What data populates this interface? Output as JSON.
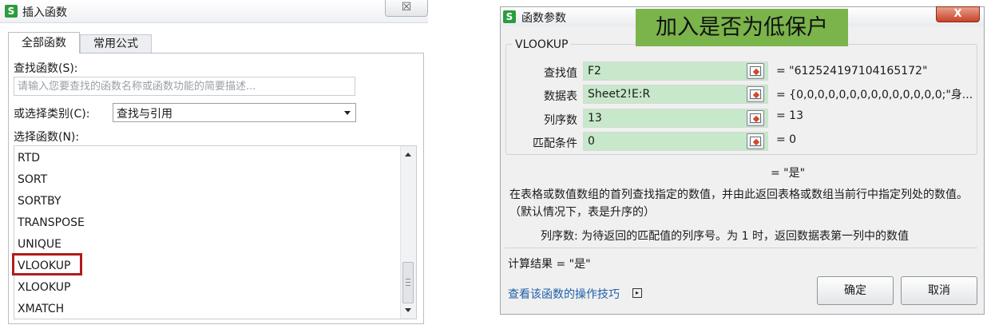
{
  "colors": {
    "app_logo": "#2c9c3e",
    "highlight_box": "#b01c1c",
    "annotation_banner": "#7ab44b",
    "arg_field_bg": "#c7e8cb",
    "link": "#1f5fa8",
    "close_button": "#c7432a"
  },
  "insert_dialog": {
    "logo": "S",
    "title": "插入函数",
    "close_glyph": "☒",
    "tabs": [
      {
        "label": "全部函数",
        "selected": true
      },
      {
        "label": "常用公式",
        "selected": false
      }
    ],
    "search_label": "查找函数(S):",
    "search_placeholder": "请输入您要查找的函数名称或函数功能的简要描述...",
    "category_label": "或选择类别(C):",
    "category_value": "查找与引用",
    "function_label": "选择函数(N):",
    "functions": [
      "RTD",
      "SORT",
      "SORTBY",
      "TRANSPOSE",
      "UNIQUE",
      "VLOOKUP",
      "XLOOKUP",
      "XMATCH"
    ],
    "selected_function": "VLOOKUP"
  },
  "args_dialog": {
    "logo": "S",
    "title": "函数参数",
    "close_glyph": "X",
    "annotation": "加入是否为低保户",
    "group_title": "VLOOKUP",
    "args": [
      {
        "label": "查找值",
        "value": "F2",
        "result": "= \"612524197104165172\""
      },
      {
        "label": "数据表",
        "value": "Sheet2!E:R",
        "result": "= {0,0,0,0,0,0,0,0,0,0,0,0,0,0;\"身..."
      },
      {
        "label": "列序数",
        "value": "13",
        "result": "= 13"
      },
      {
        "label": "匹配条件",
        "value": "0",
        "result": "= 0"
      }
    ],
    "formula_result": "= \"是\"",
    "description": "在表格或数值数组的首列查找指定的数值，并由此返回表格或数组当前行中指定列处的数值。（默认情况下，表是升序的）",
    "param_description": "列序数:  为待返回的匹配值的列序号。为 1 时，返回数据表第一列中的数值",
    "calc_result": "计算结果 = \"是\"",
    "help_link": "查看该函数的操作技巧",
    "ok_label": "确定",
    "cancel_label": "取消"
  }
}
